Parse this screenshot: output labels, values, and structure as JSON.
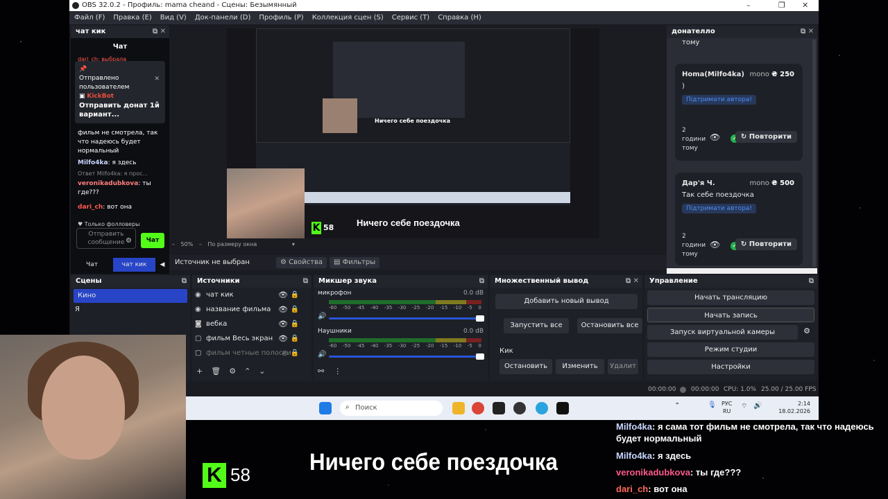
{
  "window": {
    "title": "OBS 32.0.2 - Профиль: mama cheand - Сцены: Безымянный",
    "controls": [
      "–",
      "❐",
      "✕"
    ]
  },
  "menu": [
    "Файл (F)",
    "Правка (E)",
    "Вид (V)",
    "Док-панели (D)",
    "Профиль (P)",
    "Коллекция сцен (S)",
    "Сервис (T)",
    "Справка (H)"
  ],
  "chat_dock": {
    "title": "чат кик",
    "chat_title": "Чат",
    "top_line": "dari_ch: выбрала",
    "pinned_label": "Отправлено пользователем",
    "pinned_bot": "KickBot",
    "pinned_text": "Отправить донат 1й вариант...",
    "messages": [
      {
        "user": "",
        "text": "фильм не смотрела, так что надеюсь будет нормальный"
      },
      {
        "user": "Milfo4ka",
        "text": "я здесь"
      },
      {
        "user": "",
        "text": "Ответ Milfo4ka: я прос..."
      },
      {
        "user": "veronikadubkova",
        "text": "ты где???"
      },
      {
        "user": "dari_ch",
        "text": "вот она"
      }
    ],
    "followers_only": "Только фолловеры",
    "input_placeholder": "Отправить сообщение",
    "send_label": "Чат",
    "tabs": [
      "Чат",
      "чат кик"
    ]
  },
  "preview": {
    "zoom": "50%",
    "fit_label": "По размеру окна",
    "nested_title": "Ничего себе поездочка",
    "nested_viewers": "58"
  },
  "source_bar": {
    "status": "Источник не выбран",
    "properties": "Свойства",
    "filters": "Фильтры"
  },
  "donatello": {
    "title": "донателло",
    "top_text": "тому",
    "cards": [
      {
        "name": "Homa(Milfo4ka)",
        "method": "mono",
        "amount": "₴ 250",
        "message": ")",
        "support": "Підтримати автора!",
        "time": [
          "2",
          "години",
          "тому"
        ],
        "retry": "Повторити"
      },
      {
        "name": "Дар'я Ч.",
        "method": "mono",
        "amount": "₴ 500",
        "message": "Так себе поездочка",
        "support": "Підтримати автора!",
        "time": [
          "2",
          "години",
          "тому"
        ],
        "retry": "Повторити"
      }
    ]
  },
  "scenes": {
    "title": "Сцены",
    "items": [
      "Кино",
      "Я"
    ]
  },
  "sources": {
    "title": "Источники",
    "items": [
      {
        "icon": "chat-icon",
        "label": "чат кик"
      },
      {
        "icon": "text-icon",
        "label": "название фильма"
      },
      {
        "icon": "camera-icon",
        "label": "вебка"
      },
      {
        "icon": "window-icon",
        "label": "фильм Весь экран"
      },
      {
        "icon": "window-icon",
        "label": "фильм четные полоски"
      }
    ]
  },
  "mixer": {
    "title": "Микшер звука",
    "channels": [
      {
        "name": "микрофон",
        "db": "0.0 dB"
      },
      {
        "name": "Наушники",
        "db": "0.0 dB"
      }
    ],
    "scale": [
      "-60",
      "-50",
      "-45",
      "-40",
      "-35",
      "-30",
      "-25",
      "-20",
      "-15",
      "-10",
      "-5",
      "0"
    ]
  },
  "multi_output": {
    "title": "Множественный вывод",
    "add": "Добавить новый вывод",
    "start_all": "Запустить все",
    "stop_all": "Остановить все",
    "target": "Кик",
    "stop": "Остановить",
    "edit": "Изменить",
    "delete": "Удалит"
  },
  "controls": {
    "title": "Управление",
    "buttons": [
      "Начать трансляцию",
      "Начать запись",
      "Запуск виртуальной камеры",
      "Режим студии",
      "Настройки"
    ]
  },
  "status": {
    "live_time": "00:00:00",
    "rec_time": "00:00:00",
    "cpu": "CPU: 1.0%",
    "fps": "25.00 / 25.00 FPS"
  },
  "taskbar": {
    "search": "Поиск",
    "lang": "РУС",
    "lang2": "RU",
    "time": "2:14",
    "date": "18.02.2026"
  },
  "overlay": {
    "viewers": "58",
    "title": "Ничего себе поездочка",
    "chat": [
      {
        "user": "Milfo4ka",
        "text": "я сама тот фильм не смотрела, так что надеюсь будет нормальный",
        "color": "#c7d6ff"
      },
      {
        "user": "Milfo4ka",
        "text": "я здесь",
        "color": "#c7d6ff"
      },
      {
        "user": "veronikadubkova",
        "text": "ты где???",
        "color": "#ff5a8a"
      },
      {
        "user": "dari_ch",
        "text": "вот она",
        "color": "#ff6a5a"
      }
    ]
  },
  "colors": {
    "accent": "#2845c7",
    "kick": "#53fc18",
    "bg": "#1b1c22"
  }
}
